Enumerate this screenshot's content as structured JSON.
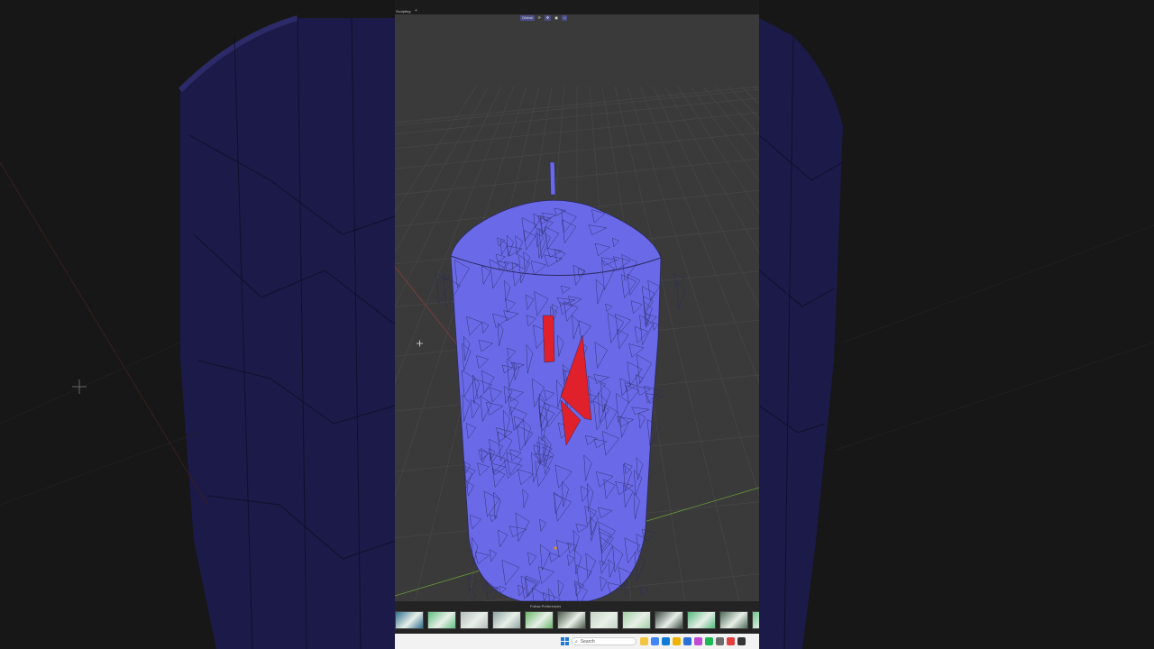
{
  "window": {
    "workspace_tab": "Sculpting",
    "add_tab": "+"
  },
  "header": {
    "orientation": "Global",
    "tools": [
      "Global",
      "⟳",
      "✥",
      "▣",
      "⌂"
    ]
  },
  "asset_browser": {
    "title": "Follow Preferences",
    "thumbnails": [
      {
        "name": "asset-thumb-1",
        "color": "#2f6f8e"
      },
      {
        "name": "asset-thumb-2",
        "color": "#5fbf7f"
      },
      {
        "name": "asset-thumb-3",
        "color": "#b7bdbd"
      },
      {
        "name": "asset-thumb-4",
        "color": "#8fa5a3"
      },
      {
        "name": "asset-thumb-5",
        "color": "#6ab86a"
      },
      {
        "name": "asset-thumb-6",
        "color": "#4c5b4c"
      },
      {
        "name": "asset-thumb-7",
        "color": "#c6d4c7"
      },
      {
        "name": "asset-thumb-8",
        "color": "#9fd0a3"
      },
      {
        "name": "asset-thumb-9",
        "color": "#3c4a44"
      },
      {
        "name": "asset-thumb-10",
        "color": "#55b97e"
      },
      {
        "name": "asset-thumb-11",
        "color": "#4e6a58"
      },
      {
        "name": "asset-thumb-12",
        "color": "#6bcb8d"
      }
    ]
  },
  "taskbar": {
    "search_placeholder": "Search",
    "icons": [
      "file-explorer-icon",
      "chrome-icon",
      "edge-icon",
      "folder-icon",
      "store-icon",
      "photos-icon",
      "spotify-icon",
      "settings-icon",
      "app-icon",
      "terminal-icon"
    ]
  },
  "colors": {
    "mesh": "#6a6ae8",
    "mesh_wire": "#2a2a60",
    "highlight": "#e0202a",
    "viewport_bg": "#3a3a3a",
    "grid": "#474747",
    "x_axis": "#8a3a3a",
    "y_axis": "#6a9a3a"
  }
}
